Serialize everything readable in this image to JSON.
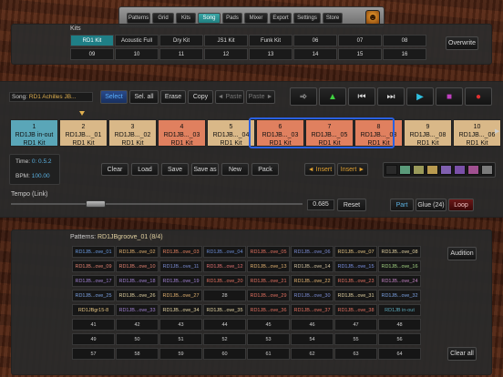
{
  "tabs": [
    "Patterns",
    "Grid",
    "Kits",
    "Song",
    "Pads",
    "Mixer",
    "Export",
    "Settings",
    "Store"
  ],
  "active_tab": "Song",
  "logo_glyph": "☻",
  "kits": {
    "label": "Kits",
    "row1": [
      "RD1 Kit",
      "Acoustic Full",
      "Dry Kit",
      "JS1 Kit",
      "Funk Kit",
      "06",
      "07",
      "08"
    ],
    "row2": [
      "09",
      "10",
      "11",
      "12",
      "13",
      "14",
      "15",
      "16"
    ],
    "overwrite": "Overwrite"
  },
  "song": {
    "name_label": "Song:",
    "name": "RD1 Achilles JB...",
    "edit_buttons": [
      "Select",
      "Sel. all",
      "Erase",
      "Copy",
      "◄ Paste",
      "Paste ►"
    ],
    "transport_icons": [
      "audio-icon",
      "metronome-icon",
      "skip-back-icon",
      "skip-forward-icon",
      "play-icon",
      "stop-icon",
      "record-icon"
    ],
    "transport_glyphs": [
      "➾",
      "▲",
      "⏮",
      "⏭",
      "▶",
      "■",
      "●"
    ],
    "pads": [
      {
        "num": "1",
        "pattern": "RD1JB in-out",
        "kit": "RD1 Kit",
        "color": "#5aa6b8"
      },
      {
        "num": "2",
        "pattern": "RD1JB..._01",
        "kit": "RD1 Kit",
        "color": "#d9b888"
      },
      {
        "num": "3",
        "pattern": "RD1JB..._02",
        "kit": "RD1 Kit",
        "color": "#d9b888"
      },
      {
        "num": "4",
        "pattern": "RD1JB..._03",
        "kit": "RD1 Kit",
        "color": "#e0805f"
      },
      {
        "num": "5",
        "pattern": "RD1JB..._04",
        "kit": "RD1 Kit",
        "color": "#d9b888"
      },
      {
        "num": "6",
        "pattern": "RD1JB..._03",
        "kit": "RD1 Kit",
        "color": "#e0805f"
      },
      {
        "num": "7",
        "pattern": "RD1JB..._05",
        "kit": "RD1 Kit",
        "color": "#e0805f"
      },
      {
        "num": "8",
        "pattern": "RD1JB..._03",
        "kit": "RD1 Kit",
        "color": "#e0805f"
      },
      {
        "num": "9",
        "pattern": "RD1JB..._08",
        "kit": "RD1 Kit",
        "color": "#d9b888"
      },
      {
        "num": "10",
        "pattern": "RD1JB..._06",
        "kit": "RD1 Kit",
        "color": "#d9b888"
      }
    ],
    "time_label": "Time:",
    "time": "0: 0.5.2",
    "bpm_label": "BPM:",
    "bpm": "100.00",
    "file_buttons": [
      "Clear",
      "Load",
      "Save",
      "Save as",
      "New",
      "Pack"
    ],
    "insert_left": "◄ Insert",
    "insert_right": "Insert ►",
    "swatches": [
      "#2a2a2a",
      "#5a9a7a",
      "#9a9a5a",
      "#b89a50",
      "#8060b0",
      "#7a50a8",
      "#a05090",
      "#7a7a7a"
    ],
    "tempo_label": "Tempo (Link)",
    "tempo_value": "0.685",
    "tempo_fraction": 0.29,
    "reset": "Reset",
    "part": "Part",
    "glue": "Glue (24)",
    "loop": "Loop"
  },
  "patterns": {
    "label": "Patterns:",
    "current": "RD1JBgroove_01 (8/4)",
    "audition": "Audition",
    "clear_all": "Clear all",
    "grid": [
      [
        [
          "RD1JB...ove_01",
          "#6a9ae0"
        ],
        [
          "RD1JB...ove_02",
          "#e0b070"
        ],
        [
          "RD1JB...ove_03",
          "#e08060"
        ],
        [
          "RD1JB...ove_04",
          "#6a8ad0"
        ],
        [
          "RD1JB...ove_05",
          "#e07060"
        ],
        [
          "RD1JB...ove_06",
          "#7a8ad0"
        ],
        [
          "RD1JB...ove_07",
          "#e0c080"
        ],
        [
          "RD1JB...ove_08",
          "#e0d0a0"
        ]
      ],
      [
        [
          "RD1JB...ove_09",
          "#e08070"
        ],
        [
          "RD1JB...ove_10",
          "#e08070"
        ],
        [
          "RD1JB...ove_11",
          "#7a8ad0"
        ],
        [
          "RD1JB...ove_12",
          "#e07070"
        ],
        [
          "RD1JB...ove_13",
          "#e0b070"
        ],
        [
          "RD1JB...ove_14",
          "#d0c0a0"
        ],
        [
          "RD1JB...ove_15",
          "#7a90e0"
        ],
        [
          "RD1JB...ove_16",
          "#a0d080"
        ]
      ],
      [
        [
          "RD1JB...ove_17",
          "#a080d0"
        ],
        [
          "RD1JB...ove_18",
          "#a080d0"
        ],
        [
          "RD1JB...ove_19",
          "#a080d0"
        ],
        [
          "RD1JB...ove_20",
          "#e07060"
        ],
        [
          "RD1JB...ove_21",
          "#e07060"
        ],
        [
          "RD1JB...ove_22",
          "#e0b070"
        ],
        [
          "RD1JB...ove_23",
          "#e07060"
        ],
        [
          "RD1JB...ove_24",
          "#c080c0"
        ]
      ],
      [
        [
          "RD1JB...ove_25",
          "#7aa0e0"
        ],
        [
          "RD1JB...ove_26",
          "#e0d0a0"
        ],
        [
          "RD1JB...ove_27",
          "#e0b070"
        ],
        [
          "28",
          "#cccccc"
        ],
        [
          "RD1JB...ove_29",
          "#e07060"
        ],
        [
          "RD1JB...ove_30",
          "#7a8ad0"
        ],
        [
          "RD1JB...ove_31",
          "#e0d0a0"
        ],
        [
          "RD1JB...ove_32",
          "#7aa0e0"
        ]
      ],
      [
        [
          "RD1JBgr15-8",
          "#e0c080"
        ],
        [
          "RD1JB...ove_33",
          "#a080d0"
        ],
        [
          "RD1JB...ove_34",
          "#e0d0a0"
        ],
        [
          "RD1JB...ove_35",
          "#e0d0a0"
        ],
        [
          "RD1JB...ove_36",
          "#e07060"
        ],
        [
          "RD1JB...ove_37",
          "#e07060"
        ],
        [
          "RD1JB...ove_38",
          "#e07060"
        ],
        [
          "RD1JB in-out",
          "#5aa6b8"
        ]
      ],
      [
        [
          "41",
          "#cccccc"
        ],
        [
          "42",
          "#cccccc"
        ],
        [
          "43",
          "#cccccc"
        ],
        [
          "44",
          "#cccccc"
        ],
        [
          "45",
          "#cccccc"
        ],
        [
          "46",
          "#cccccc"
        ],
        [
          "47",
          "#cccccc"
        ],
        [
          "48",
          "#cccccc"
        ]
      ],
      [
        [
          "49",
          "#cccccc"
        ],
        [
          "50",
          "#cccccc"
        ],
        [
          "51",
          "#cccccc"
        ],
        [
          "52",
          "#cccccc"
        ],
        [
          "53",
          "#cccccc"
        ],
        [
          "54",
          "#cccccc"
        ],
        [
          "55",
          "#cccccc"
        ],
        [
          "56",
          "#cccccc"
        ]
      ],
      [
        [
          "57",
          "#cccccc"
        ],
        [
          "58",
          "#cccccc"
        ],
        [
          "59",
          "#cccccc"
        ],
        [
          "60",
          "#cccccc"
        ],
        [
          "61",
          "#cccccc"
        ],
        [
          "62",
          "#cccccc"
        ],
        [
          "63",
          "#cccccc"
        ],
        [
          "64",
          "#cccccc"
        ]
      ]
    ]
  }
}
